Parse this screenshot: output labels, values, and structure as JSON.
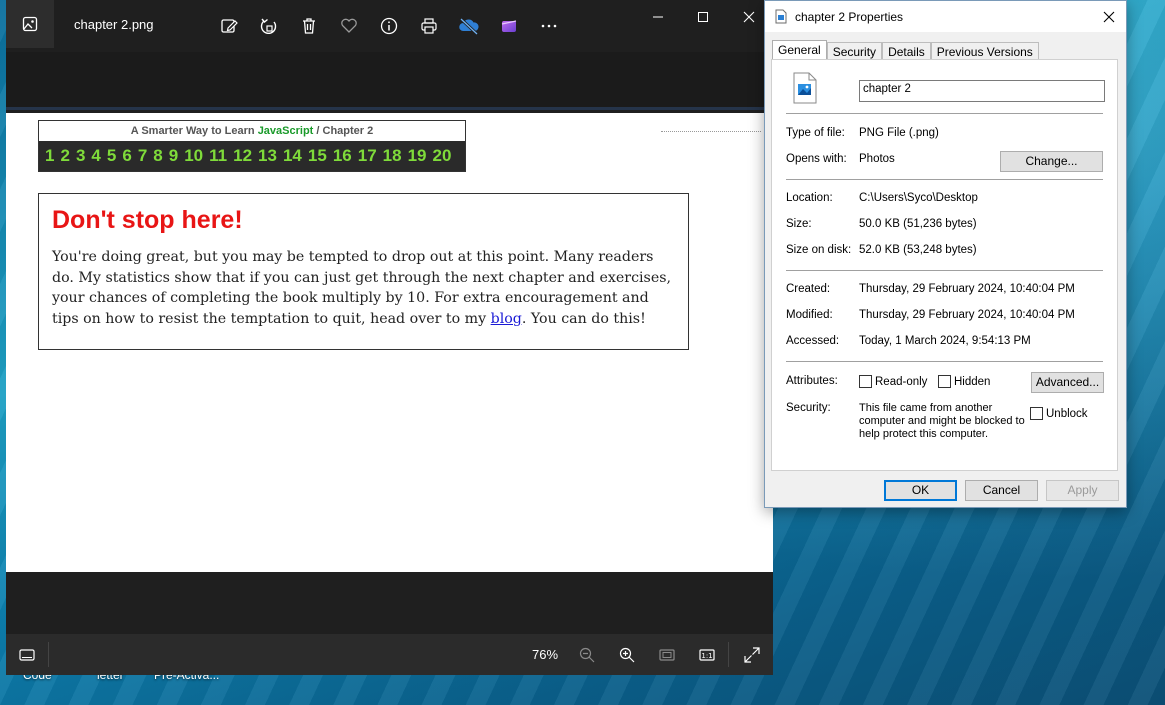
{
  "desktop": {
    "labels": [
      "Code",
      "letter",
      "Pre-Activa..."
    ]
  },
  "photos": {
    "title": "chapter 2.png",
    "toolbar_icons": [
      "edit-image-icon",
      "rotate-icon",
      "delete-icon",
      "favorite-icon",
      "info-icon",
      "print-icon",
      "onedrive-icon",
      "clipchamp-icon",
      "more-icon"
    ],
    "image": {
      "nav_header_prefix": "A Smarter Way to Learn ",
      "nav_header_js": "JavaScript",
      "nav_header_suffix": " / Chapter 2",
      "chapters": [
        "1",
        "2",
        "3",
        "4",
        "5",
        "6",
        "7",
        "8",
        "9",
        "10",
        "11",
        "12",
        "13",
        "14",
        "15",
        "16",
        "17",
        "18",
        "19",
        "20"
      ],
      "heading": "Don't stop here!",
      "body_before_link": "You're doing great, but you may be tempted to drop out at this point. Many readers do. My statistics show that if you can just get through the next chapter and exercises, your chances of completing the book multiply by 10. For extra encouragement and tips on how to resist the temptation to quit, head over to my ",
      "link_text": "blog",
      "body_after_link": ". You can do this!"
    },
    "status": {
      "zoom": "76%"
    },
    "colors": {
      "heading": "#e81515",
      "chapter_numbers": "#7fdb3a",
      "javascript": "#1a9a2a",
      "link": "#1a1ad6"
    }
  },
  "properties": {
    "title": "chapter 2 Properties",
    "tabs": [
      "General",
      "Security",
      "Details",
      "Previous Versions"
    ],
    "file_name": "chapter 2",
    "type_label": "Type of file:",
    "type_value": "PNG File (.png)",
    "opens_label": "Opens with:",
    "opens_value": "Photos",
    "change_button": "Change...",
    "location_label": "Location:",
    "location_value": "C:\\Users\\Syco\\Desktop",
    "size_label": "Size:",
    "size_value": "50.0 KB (51,236 bytes)",
    "size_disk_label": "Size on disk:",
    "size_disk_value": "52.0 KB (53,248 bytes)",
    "created_label": "Created:",
    "created_value": "Thursday, 29 February 2024, 10:40:04 PM",
    "modified_label": "Modified:",
    "modified_value": "Thursday, 29 February 2024, 10:40:04 PM",
    "accessed_label": "Accessed:",
    "accessed_value": "Today, 1 March 2024, 9:54:13 PM",
    "attributes_label": "Attributes:",
    "readonly_label": "Read-only",
    "hidden_label": "Hidden",
    "advanced_button": "Advanced...",
    "security_label": "Security:",
    "security_text": "This file came from another computer and might be blocked to help protect this computer.",
    "unblock_label": "Unblock",
    "ok_button": "OK",
    "cancel_button": "Cancel",
    "apply_button": "Apply"
  }
}
